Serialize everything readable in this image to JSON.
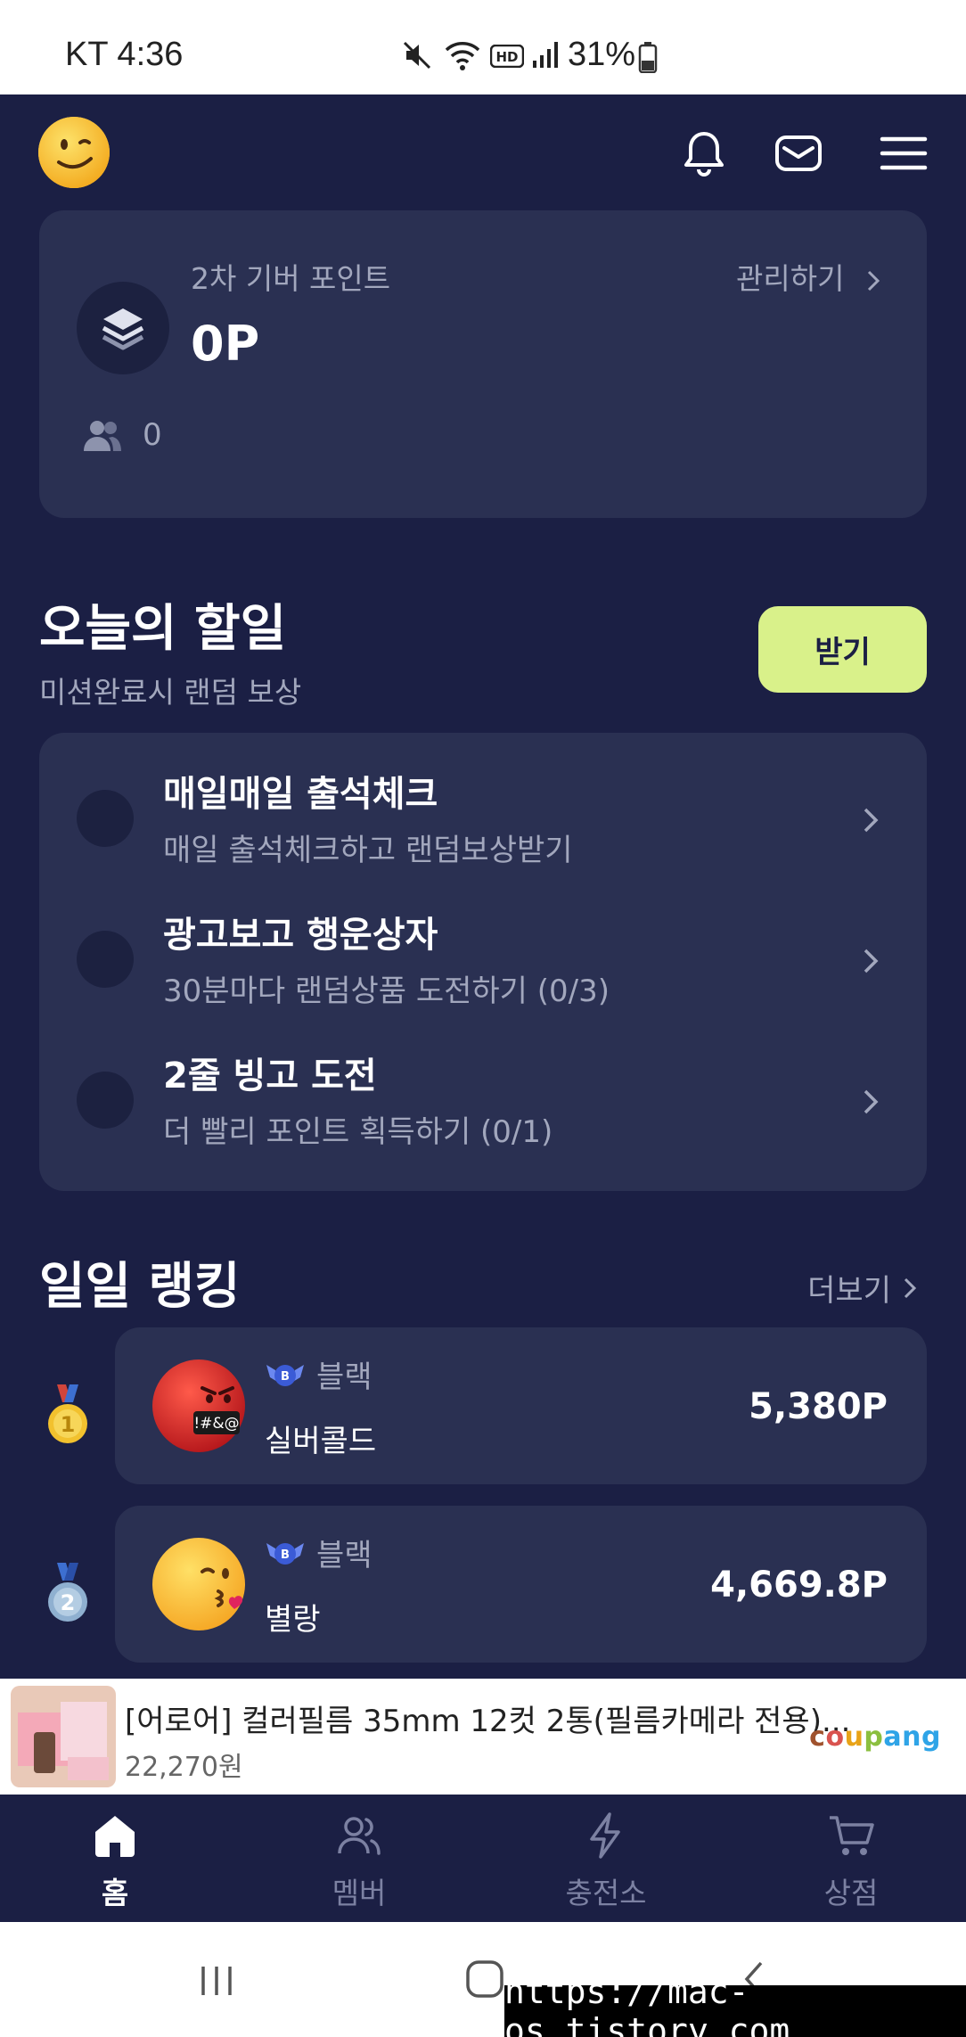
{
  "status_bar": {
    "carrier_time": "KT 4:36",
    "battery": "31%"
  },
  "header": {
    "avatar_icon": "winking-face-emoji",
    "icons": [
      "bell-icon",
      "mail-icon",
      "menu-icon"
    ]
  },
  "point_card": {
    "label": "2차 기버 포인트",
    "value": "0P",
    "manage": "관리하기",
    "member_count": "0"
  },
  "today_tasks": {
    "title": "오늘의 할일",
    "subtitle": "미션완료시 랜덤 보상",
    "button": "받기",
    "items": [
      {
        "title": "매일매일 출석체크",
        "desc": "매일 출석체크하고 랜덤보상받기"
      },
      {
        "title": "광고보고 행운상자",
        "desc": "30분마다 랜덤상품 도전하기 (0/3)"
      },
      {
        "title": "2줄 빙고 도전",
        "desc": "더 빨리 포인트 획득하기 (0/1)"
      }
    ]
  },
  "ranking": {
    "title": "일일 랭킹",
    "more": "더보기",
    "items": [
      {
        "rank": "1",
        "tier": "블랙",
        "name": "실버콜드",
        "points": "5,380P",
        "emoji": "cursing-face-emoji"
      },
      {
        "rank": "2",
        "tier": "블랙",
        "name": "별랑",
        "points": "4,669.8P",
        "emoji": "kissing-face-emoji"
      }
    ]
  },
  "ad": {
    "title": "[어로어] 컬러필름 35mm 12컷 2통(필름카메라 전용)...",
    "price": "22,270원",
    "brand": "coupang"
  },
  "bottom_nav": [
    {
      "label": "홈",
      "active": true
    },
    {
      "label": "멤버",
      "active": false
    },
    {
      "label": "충전소",
      "active": false
    },
    {
      "label": "상점",
      "active": false
    }
  ],
  "watermark": "https://mac-os.tistory.com",
  "colors": {
    "background": "#1b1f44",
    "card": "#2a3052",
    "accent": "#d9f18a",
    "muted": "#a2a7bd"
  }
}
